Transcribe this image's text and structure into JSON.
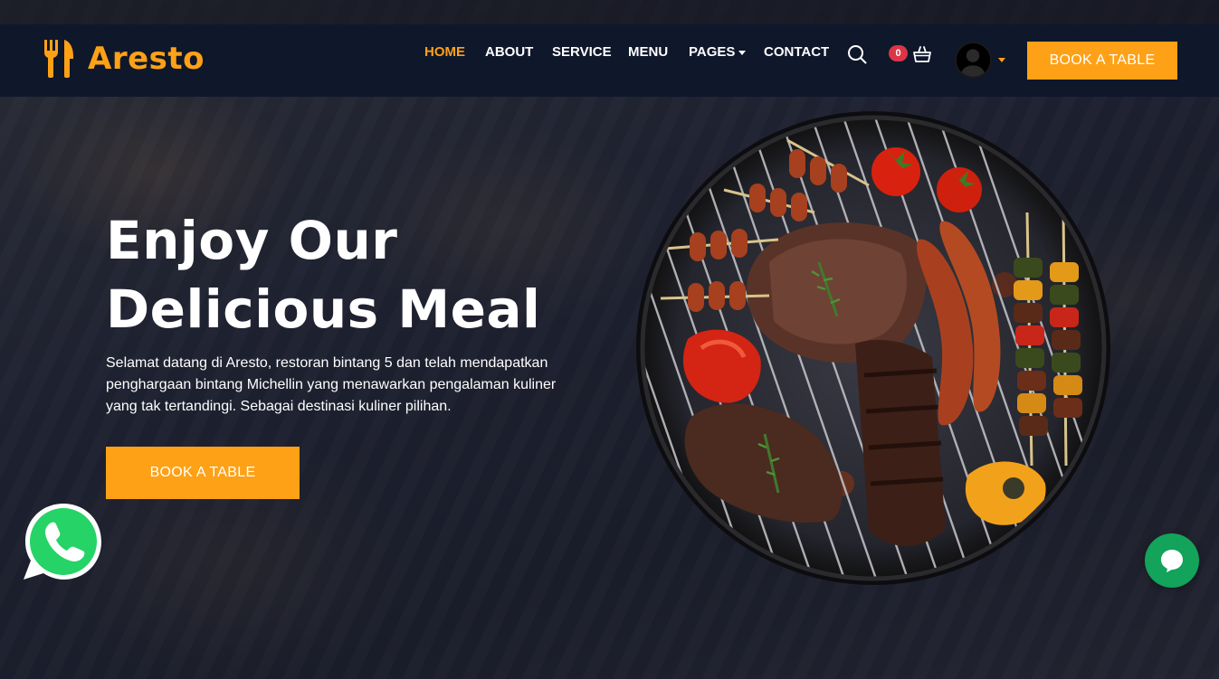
{
  "brand": {
    "name": "Aresto",
    "accent": "#FEA116"
  },
  "nav": {
    "items": [
      {
        "label": "HOME",
        "active": true
      },
      {
        "label": "ABOUT"
      },
      {
        "label": "SERVICE"
      },
      {
        "label": "MENU"
      },
      {
        "label": "PAGES",
        "dropdown": true
      },
      {
        "label": "CONTACT"
      }
    ],
    "cart_count": "0",
    "book_label": "BOOK A TABLE"
  },
  "hero": {
    "title_line1": "Enjoy Our",
    "title_line2": "Delicious Meal",
    "description": "Selamat datang di Aresto, restoran bintang 5 dan telah mendapatkan penghargaan bintang Michellin yang menawarkan pengalaman kuliner yang tak tertandingi. Sebagai destinasi kuliner pilihan.",
    "button_label": "BOOK A TABLE"
  },
  "colors": {
    "navbar": "#0f172b",
    "primary": "#FEA116",
    "badge": "#dc3545",
    "whatsapp": "#25D366",
    "chat": "#13a35a"
  },
  "icons": [
    "utensils-icon",
    "search-icon",
    "cart-icon",
    "user-avatar-icon",
    "whatsapp-icon",
    "chat-icon"
  ]
}
